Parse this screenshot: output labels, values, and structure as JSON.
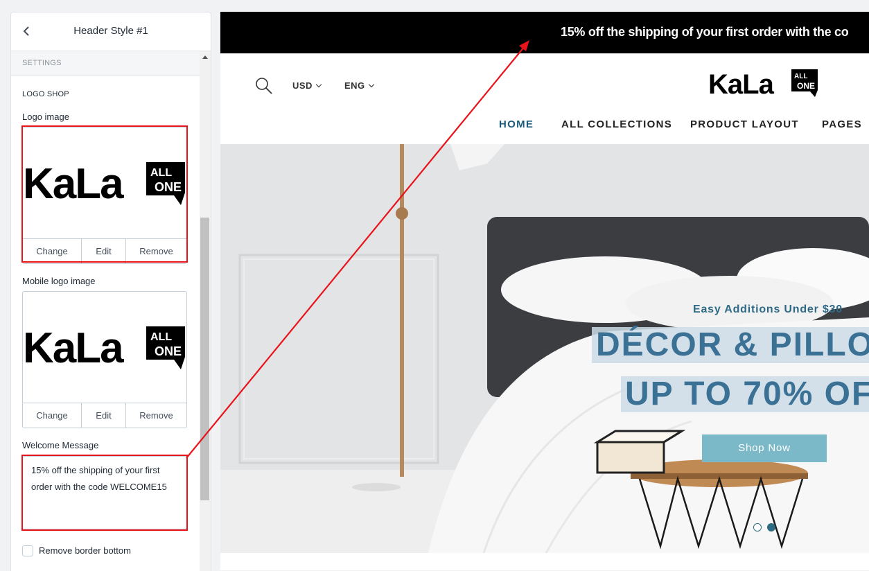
{
  "panel": {
    "title": "Header Style #1",
    "settings_label": "SETTINGS",
    "section_title": "LOGO SHOP",
    "logo_image": {
      "label": "Logo image",
      "logo_text": "KaLa",
      "actions": {
        "change": "Change",
        "edit": "Edit",
        "remove": "Remove"
      }
    },
    "mobile_logo_image": {
      "label": "Mobile logo image",
      "logo_text": "KaLa",
      "actions": {
        "change": "Change",
        "edit": "Edit",
        "remove": "Remove"
      }
    },
    "welcome_message": {
      "label": "Welcome Message",
      "value": "15% off the shipping of your first order with the code WELCOME15"
    },
    "remove_border_bottom": {
      "label": "Remove border bottom",
      "checked": false
    }
  },
  "preview": {
    "announcement": "15% off the shipping of your first order with the co",
    "currency": "USD",
    "language": "ENG",
    "logo_text": "KaLa",
    "nav": [
      "HOME",
      "ALL COLLECTIONS",
      "PRODUCT LAYOUT",
      "PAGES"
    ],
    "hero": {
      "subtitle": "Easy Additions Under $30",
      "title_line1": "DÉCOR & PILLO",
      "title_line2": "UP TO 70% OF",
      "cta": "Shop Now",
      "slides": 2,
      "active_slide": 2
    }
  },
  "colors": {
    "highlight": "#e8131b",
    "announcement_bg": "#000000",
    "nav_active": "#1a5a7a",
    "hero_text": "#3a7194",
    "cta_bg": "#7bb9c9"
  }
}
